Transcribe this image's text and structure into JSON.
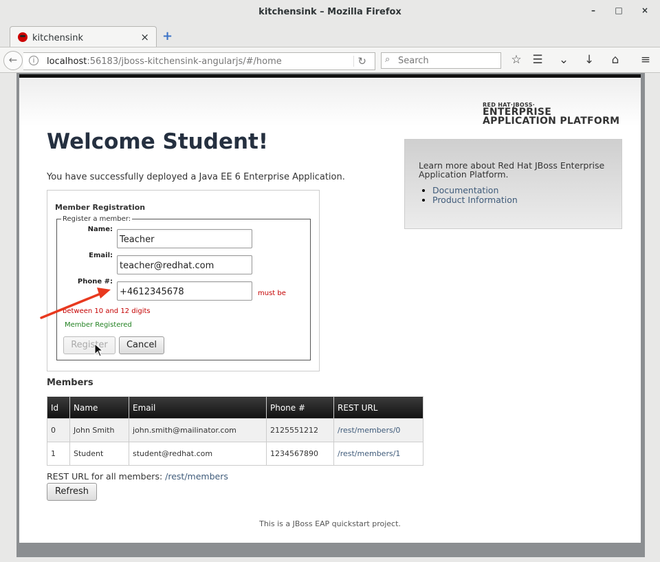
{
  "window": {
    "title": "kitchensink – Mozilla Firefox",
    "minimize": "–",
    "maximize": "□",
    "close": "×"
  },
  "tab": {
    "label": "kitchensink",
    "close": "×",
    "new": "+"
  },
  "nav": {
    "url_host": "localhost",
    "url_rest": ":56183/jboss-kitchensink-angularjs/#/home",
    "search_placeholder": "Search",
    "back": "←",
    "info": "i",
    "reload": "↻",
    "search_glyph": "⌕",
    "star": "☆",
    "reading_list": "☰",
    "pocket": "⌄",
    "download": "↓",
    "home": "⌂",
    "menu": "≡"
  },
  "page": {
    "logo_line1": "RED HAT·JBOSS·",
    "logo_line2": "ENTERPRISE",
    "logo_line3": "APPLICATION PLATFORM",
    "heading": "Welcome Student!",
    "deploy_text": "You have successfully deployed a Java EE 6 Enterprise Application.",
    "registration": {
      "title": "Member Registration",
      "legend": "Register a member:",
      "name_label": "Name:",
      "name_value": "Teacher",
      "email_label": "Email:",
      "email_value": "teacher@redhat.com",
      "phone_label": "Phone #:",
      "phone_value": "+4612345678",
      "phone_error_1": "must be",
      "phone_error_2": "between 10 and 12 digits",
      "success": "Member Registered",
      "register_button": "Register",
      "cancel_button": "Cancel"
    },
    "sidebar": {
      "text": "Learn more about Red Hat JBoss Enterprise Application Platform.",
      "links": [
        "Documentation",
        "Product Information"
      ]
    },
    "members": {
      "heading": "Members",
      "columns": [
        "Id",
        "Name",
        "Email",
        "Phone #",
        "REST URL"
      ],
      "rows": [
        [
          "0",
          "John Smith",
          "john.smith@mailinator.com",
          "2125551212",
          "/rest/members/0"
        ],
        [
          "1",
          "Student",
          "student@redhat.com",
          "1234567890",
          "/rest/members/1"
        ]
      ],
      "rest_all_label": "REST URL for all members: ",
      "rest_all_link": "/rest/members",
      "refresh_button": "Refresh"
    },
    "footer": "This is a JBoss EAP quickstart project."
  },
  "colors": {
    "error": "#c40000",
    "success": "#208020",
    "link": "#3f5b7a",
    "annotation_arrow": "#e8391f"
  }
}
